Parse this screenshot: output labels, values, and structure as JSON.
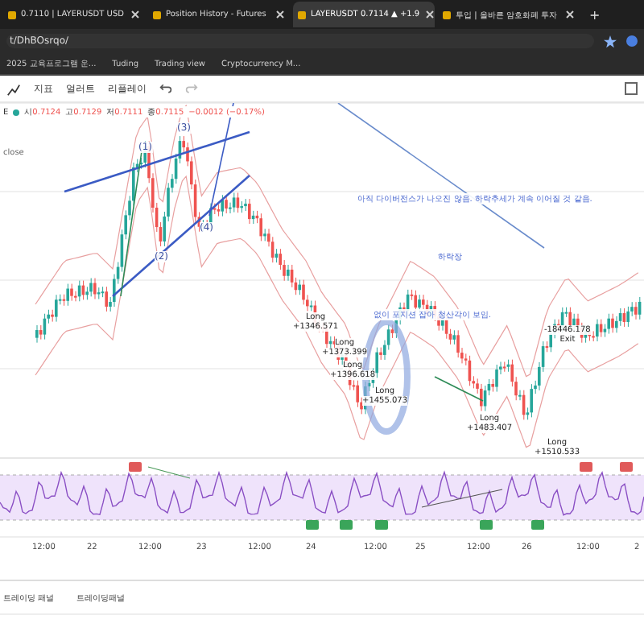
{
  "browser": {
    "tabs": [
      {
        "label": "0.7110 | LAYERUSDT USD",
        "selected": false
      },
      {
        "label": "Position History - Futures",
        "selected": false
      },
      {
        "label": "LAYERUSDT 0.7114 ▲ +1.9",
        "selected": true
      },
      {
        "label": "투입 | 올바른 암호화폐 투자",
        "selected": false
      }
    ],
    "new_tab": "+",
    "address": "t/DhBOsrqo/",
    "bookmarks": [
      {
        "label": "2025 교육프로그램 운..."
      },
      {
        "label": "Tuding"
      },
      {
        "label": "Trading view"
      },
      {
        "label": "Cryptocurrency M..."
      }
    ]
  },
  "toolbar": {
    "items": [
      {
        "label": "지표"
      },
      {
        "label": "얼러트"
      },
      {
        "label": "리플레이"
      }
    ]
  },
  "legend": {
    "symbol": "E",
    "ohlc": [
      {
        "label": "시",
        "value": "0.7124"
      },
      {
        "label": "고",
        "value": "0.7129"
      },
      {
        "label": "저",
        "value": "0.7111"
      },
      {
        "label": "종",
        "value": "0.7115"
      }
    ],
    "change": "−0.0012 (−0.17%)",
    "indicator": "close"
  },
  "chart": {
    "notes": [
      {
        "text": "아직 다이버전스가 나오진 않음. 하락추세가 계속 이어질 것 같음."
      },
      {
        "text": "하락장"
      },
      {
        "text": "없이 포지션 잡아 청산각이 보임."
      }
    ],
    "wave_labels": [
      "(1)",
      "(3)",
      "(2)",
      "(4)"
    ],
    "trades": [
      {
        "kind": "entry",
        "side": "Long",
        "pnl": "+1346.571"
      },
      {
        "kind": "entry",
        "side": "Long",
        "pnl": "+1373.399"
      },
      {
        "kind": "entry",
        "side": "Long",
        "pnl": "+1396.618"
      },
      {
        "kind": "entry",
        "side": "Long",
        "pnl": "+1455.073"
      },
      {
        "kind": "entry",
        "side": "Long",
        "pnl": "+1483.407"
      },
      {
        "kind": "exit",
        "side": "Exit",
        "pnl": "-18446.178"
      },
      {
        "kind": "entry",
        "side": "Long",
        "pnl": "+1510.533"
      }
    ]
  },
  "time_axis": [
    "12:00",
    "22",
    "12:00",
    "23",
    "12:00",
    "24",
    "12:00",
    "25",
    "12:00",
    "26",
    "12:00",
    "2"
  ],
  "bottom_panel": {
    "tabs": [
      "트레이딩 패널",
      "트레이딩패널"
    ]
  }
}
